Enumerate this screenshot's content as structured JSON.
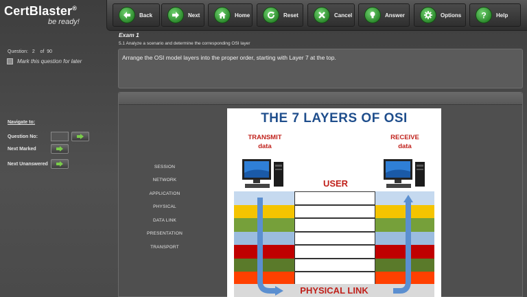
{
  "app": {
    "name": "CertBlaster",
    "trademark": "®",
    "tagline": "be ready!"
  },
  "toolbar": {
    "buttons": [
      {
        "label": "Back",
        "icon": "arrow-left-icon"
      },
      {
        "label": "Next",
        "icon": "arrow-right-icon"
      },
      {
        "label": "Home",
        "icon": "home-icon"
      },
      {
        "label": "Reset",
        "icon": "reset-icon"
      },
      {
        "label": "Cancel",
        "icon": "close-icon"
      },
      {
        "label": "Answer",
        "icon": "lightbulb-icon"
      },
      {
        "label": "Options",
        "icon": "gear-icon"
      },
      {
        "label": "Help",
        "icon": "question-icon"
      }
    ],
    "icon_color": "#2e8b2e"
  },
  "question_status": {
    "question_label": "Question:",
    "current": "2",
    "of_label": "of",
    "total": "90",
    "mark_later_label": "Mark this question for later",
    "mark_later_checked": false
  },
  "navigate": {
    "title": "Navigate to:",
    "question_no_label": "Question No:",
    "question_no_value": "",
    "next_marked_label": "Next Marked",
    "next_unanswered_label": "Next Unanswered"
  },
  "exam": {
    "title": "Exam 1",
    "objective": "5.1 Analyze a scenario and determine the corresponding OSI layer",
    "question": "Arrange the OSI model layers into the proper order, starting with Layer 7 at the top."
  },
  "choices": [
    "SESSION",
    "NETWORK",
    "APPLICATION",
    "PHYSICAL",
    "DATA LINK",
    "PRESENTATION",
    "TRANSPORT"
  ],
  "diagram": {
    "title": "THE 7 LAYERS OF OSI",
    "transmit_line1": "TRANSMIT",
    "transmit_line2": "data",
    "receive_line1": "RECEIVE",
    "receive_line2": "data",
    "user_label": "USER",
    "physical_link_label": "PHYSICAL LINK",
    "band_colors": [
      "#c5d9ef",
      "#f5c400",
      "#76a03a",
      "#9bbcdf",
      "#c00000",
      "#5a7a2a",
      "#ff4000"
    ],
    "title_color": "#1f4e8c",
    "label_color": "#c0201a",
    "arrow_color": "#5b8fd0",
    "slots": [
      "",
      "",
      "",
      "",
      "",
      "",
      ""
    ]
  }
}
